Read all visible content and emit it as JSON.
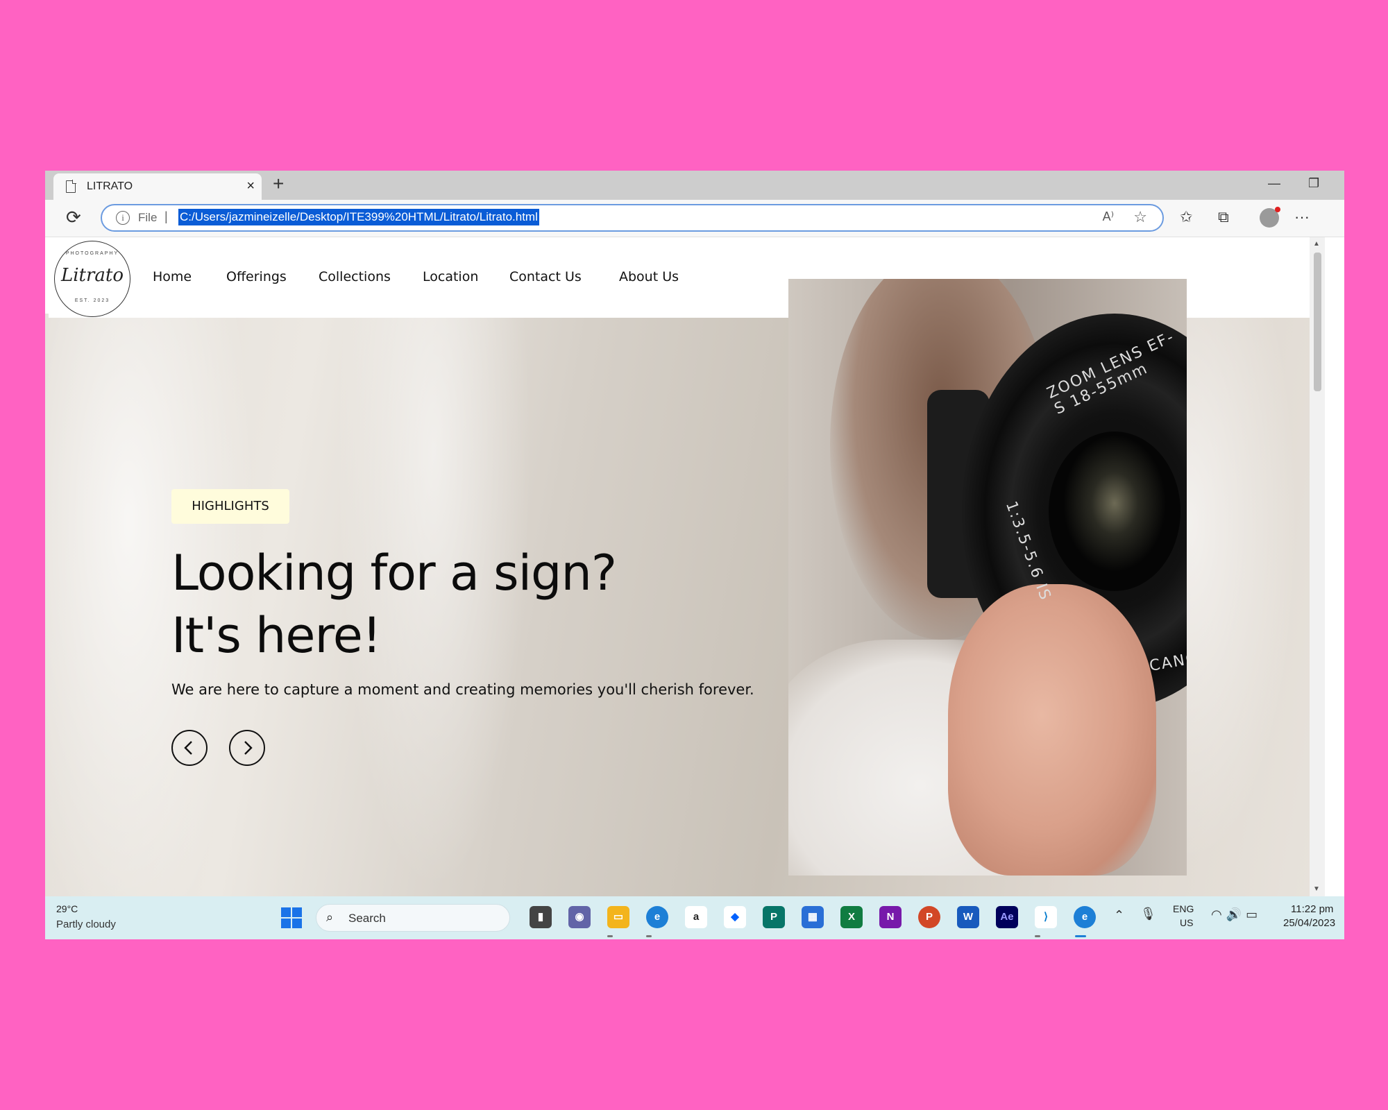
{
  "browser": {
    "tab_title": "LITRATO",
    "tab_close": "×",
    "new_tab": "+",
    "minimize": "—",
    "restore": "❐",
    "address_prefix": "File",
    "address_separator": "|",
    "url": "C:/Users/jazmineizelle/Desktop/ITE399%20HTML/Litrato/Litrato.html",
    "icons": [
      "reload-icon",
      "info-icon",
      "read-aloud-icon",
      "add-favorite-icon",
      "favorites-icon",
      "collections-icon",
      "profile-icon",
      "more-icon"
    ]
  },
  "site": {
    "logo": {
      "top_text": "PHOTOGRAPHY",
      "script": "Litrato",
      "bottom_text": "EST. 2023"
    },
    "nav": [
      "Home",
      "Offerings",
      "Collections",
      "Location",
      "Contact Us",
      "About Us"
    ],
    "hero": {
      "badge": "HIGHLIGHTS",
      "headline_line1": "Looking for a sign?",
      "headline_line2": "It's here!",
      "tagline": "We are here to capture a moment and creating memories you'll cherish forever.",
      "prev_icon": "chevron-left-icon",
      "next_icon": "chevron-right-icon",
      "lens_text_1": "ZOOM LENS EF-S 18-55mm",
      "lens_text_2": "1:3.5-5.6 IS",
      "lens_text_3": "CANO"
    },
    "colors": {
      "badge_bg": "#fffcdc",
      "text": "#111111"
    }
  },
  "taskbar": {
    "weather_temp": "29°C",
    "weather_desc": "Partly cloudy",
    "search_label": "Search",
    "apps": [
      "file-explorer-icon",
      "teams-icon",
      "folder-icon",
      "edge-icon",
      "amazon-icon",
      "dropbox-icon",
      "publisher-icon",
      "store-icon",
      "excel-icon",
      "onenote-icon",
      "powerpoint-icon",
      "word-icon",
      "after-effects-icon",
      "vscode-icon",
      "edge-dev-icon"
    ],
    "lang_line1": "ENG",
    "lang_line2": "US",
    "time": "11:22 pm",
    "date": "25/04/2023"
  }
}
